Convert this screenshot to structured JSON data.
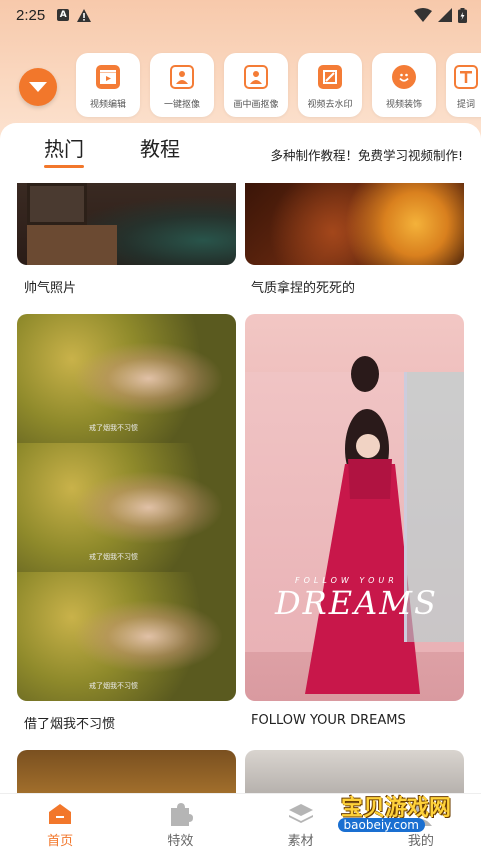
{
  "status_bar": {
    "time": "2:25",
    "icons": [
      "a-icon",
      "warning-icon",
      "wifi-icon",
      "signal-icon",
      "battery-icon"
    ]
  },
  "toolbar": {
    "menu_icon": "chevron-down-icon",
    "tools": [
      {
        "label": "视频编辑",
        "icon": "clapperboard-icon"
      },
      {
        "label": "一键抠像",
        "icon": "portrait-icon"
      },
      {
        "label": "画中画抠像",
        "icon": "picture-in-picture-icon"
      },
      {
        "label": "视频去水印",
        "icon": "eraser-icon"
      },
      {
        "label": "视频装饰",
        "icon": "smile-icon"
      },
      {
        "label": "提词",
        "icon": "text-icon"
      }
    ]
  },
  "tabs": [
    {
      "label": "热门",
      "active": true
    },
    {
      "label": "教程",
      "active": false
    }
  ],
  "tagline": "多种制作教程！免费学习视频制作!",
  "cards": {
    "row1_left_caption": "帅气照片",
    "row1_right_caption": "气质拿捏的死死的",
    "row2_left_caption": "借了烟我不习惯",
    "row2_right_caption": "FOLLOW YOUR DREAMS",
    "girl_subtitle": "戒了烟我不习惯",
    "dreams_small": "FOLLOW YOUR",
    "dreams_big": "DREAMS"
  },
  "bottom_nav": [
    {
      "label": "首页",
      "icon": "home-icon",
      "active": true
    },
    {
      "label": "特效",
      "icon": "puzzle-icon",
      "active": false
    },
    {
      "label": "素材",
      "icon": "layers-icon",
      "active": false
    },
    {
      "label": "我的",
      "icon": "user-icon",
      "active": false
    }
  ],
  "watermark": {
    "text": "宝贝游戏网",
    "url": "baobeiy.com"
  },
  "colors": {
    "accent": "#f2772b",
    "top_gradient": "#f7c9ab"
  }
}
